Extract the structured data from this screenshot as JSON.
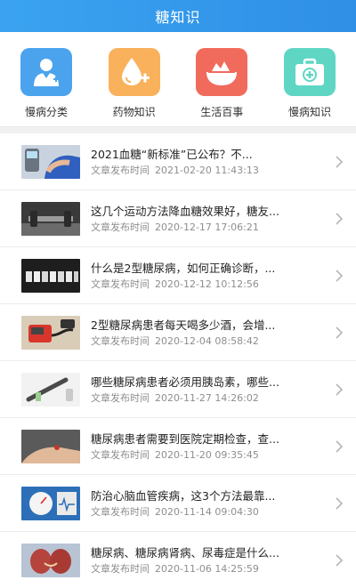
{
  "header": {
    "title": "糖知识"
  },
  "categories": [
    {
      "label": "慢病分类",
      "icon": "doctor-icon",
      "color": "#4ba3ee"
    },
    {
      "label": "药物知识",
      "icon": "drop-plus-icon",
      "color": "#f7a64f"
    },
    {
      "label": "生活百事",
      "icon": "food-bowl-icon",
      "color": "#f16b5c"
    },
    {
      "label": "慢病知识",
      "icon": "medical-kit-icon",
      "color": "#4dcfbd"
    }
  ],
  "articles": [
    {
      "title": "2021血糖“新标准”已公布？不...",
      "meta_label": "文章发布时间",
      "date": "2021-02-20 11:43:13"
    },
    {
      "title": "这几个运动方法降血糖效果好，糖友...",
      "meta_label": "文章发布时间",
      "date": "2020-12-17 17:06:21"
    },
    {
      "title": "什么是2型糖尿病，如何正确诊断，...",
      "meta_label": "文章发布时间",
      "date": "2020-12-12 10:12:56"
    },
    {
      "title": "2型糖尿病患者每天喝多少酒，会增...",
      "meta_label": "文章发布时间",
      "date": "2020-12-04 08:58:42"
    },
    {
      "title": "哪些糖尿病患者必须用胰岛素，哪些...",
      "meta_label": "文章发布时间",
      "date": "2020-11-27 14:26:02"
    },
    {
      "title": "糖尿病患者需要到医院定期检查，查...",
      "meta_label": "文章发布时间",
      "date": "2020-11-20 09:35:45"
    },
    {
      "title": "防治心脑血管疾病，这3个方法最靠...",
      "meta_label": "文章发布时间",
      "date": "2020-11-14 09:04:30"
    },
    {
      "title": "糖尿病、糖尿病肾病、尿毒症是什么...",
      "meta_label": "文章发布时间",
      "date": "2020-11-06 14:25:59"
    }
  ]
}
